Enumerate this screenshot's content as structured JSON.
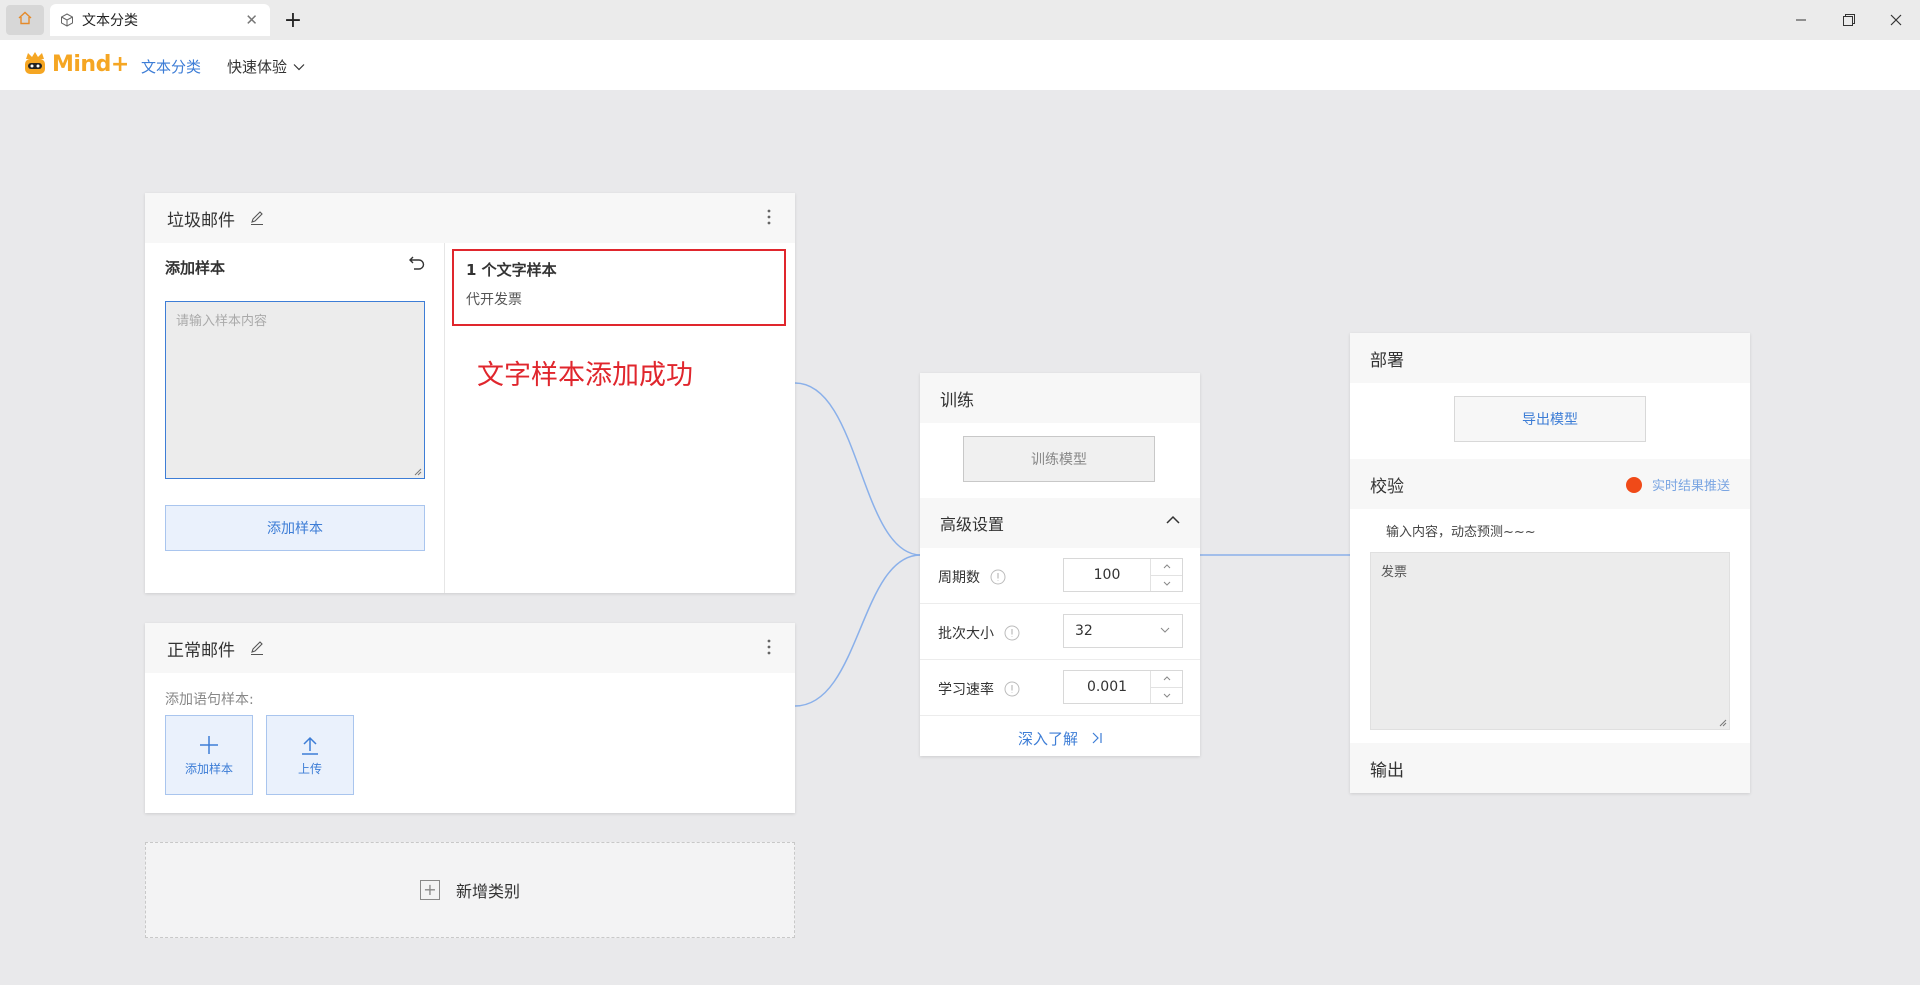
{
  "titlebar": {
    "tab_title": "文本分类"
  },
  "header": {
    "logo_text": "Mind+",
    "nav_active": "文本分类",
    "nav_menu": "快速体验"
  },
  "class_spam": {
    "title": "垃圾邮件",
    "add_sample_title": "添加样本",
    "input_placeholder": "请输入样本内容",
    "add_button": "添加样本",
    "sample_count": "1 个文字样本",
    "samples": [
      "代开发票"
    ],
    "success_note": "文字样本添加成功"
  },
  "class_normal": {
    "title": "正常邮件",
    "add_label": "添加语句样本:",
    "add_tile": "添加样本",
    "upload_tile": "上传"
  },
  "add_class": {
    "label": "新增类别"
  },
  "training": {
    "title": "训练",
    "train_button": "训练模型",
    "advanced_title": "高级设置",
    "params": {
      "epochs": {
        "label": "周期数",
        "value": "100"
      },
      "batch": {
        "label": "批次大小",
        "value": "32"
      },
      "lr": {
        "label": "学习速率",
        "value": "0.001"
      }
    },
    "learn_more": "深入了解"
  },
  "deploy": {
    "title": "部署",
    "export_button": "导出模型",
    "verify_title": "校验",
    "realtime_label": "实时结果推送",
    "predict_hint": "输入内容，动态预测~~~",
    "verify_value": "发票",
    "output_title": "输出"
  },
  "colors": {
    "accent": "#3d7dd6",
    "highlight_red": "#e0262d",
    "realtime_dot": "#f04a18"
  }
}
